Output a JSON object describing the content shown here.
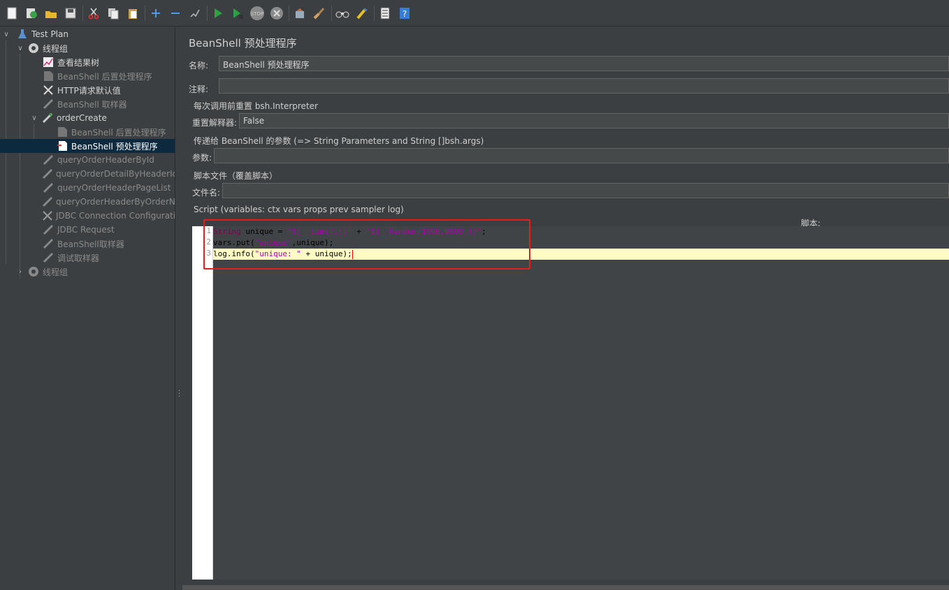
{
  "toolbar": {
    "buttons": [
      "new-icon",
      "templates-icon",
      "open-icon",
      "save-icon",
      "cut-icon",
      "copy-icon",
      "paste-icon",
      "expand-icon",
      "collapse-icon",
      "toggle-icon",
      "start-icon",
      "start-no-pause-icon",
      "stop-icon",
      "shutdown-icon",
      "clear-icon",
      "clear-all-icon",
      "search-icon",
      "reset-search-icon",
      "function-helper-icon",
      "help-icon"
    ]
  },
  "tree": {
    "items": [
      {
        "label": "Test Plan",
        "state": "active",
        "icon": "flask-icon"
      },
      {
        "label": "线程组",
        "state": "active",
        "icon": "gear-icon"
      },
      {
        "label": "查看结果树",
        "state": "active",
        "icon": "chart-icon"
      },
      {
        "label": "BeanShell 后置处理程序",
        "state": "disabled",
        "icon": "doc-icon"
      },
      {
        "label": "HTTP请求默认值",
        "state": "active",
        "icon": "wrench-icon"
      },
      {
        "label": "BeanShell 取样器",
        "state": "disabled",
        "icon": "pipette-icon"
      },
      {
        "label": "orderCreate",
        "state": "active",
        "icon": "pipette-icon"
      },
      {
        "label": "BeanShell 后置处理程序",
        "state": "disabled",
        "icon": "doc-icon"
      },
      {
        "label": "BeanShell 预处理程序",
        "state": "selected",
        "icon": "preprocessor-icon"
      },
      {
        "label": "queryOrderHeaderById",
        "state": "disabled",
        "icon": "pipette-icon"
      },
      {
        "label": "queryOrderDetailByHeaderId",
        "state": "disabled",
        "icon": "pipette-icon"
      },
      {
        "label": "queryOrderHeaderPageList",
        "state": "disabled",
        "icon": "pipette-icon"
      },
      {
        "label": "queryOrderHeaderByOrderNum",
        "state": "disabled",
        "icon": "pipette-icon"
      },
      {
        "label": "JDBC Connection Configuration",
        "state": "disabled",
        "icon": "wrench-icon"
      },
      {
        "label": "JDBC Request",
        "state": "disabled",
        "icon": "pipette-icon"
      },
      {
        "label": "BeanShell取样器",
        "state": "disabled",
        "icon": "pipette-icon"
      },
      {
        "label": "调试取样器",
        "state": "disabled",
        "icon": "pipette-icon"
      },
      {
        "label": "线程组",
        "state": "disabled",
        "icon": "gear-icon"
      }
    ]
  },
  "panel": {
    "title": "BeanShell 预处理程序",
    "name_label": "名称:",
    "name_value": "BeanShell 预处理程序",
    "comment_label": "注释:",
    "comment_value": "",
    "reset_group_title": "每次调用前重置 bsh.Interpreter",
    "reset_label": "重置解释器:",
    "reset_value": "False",
    "params_group_title": "传递给 BeanShell 的参数 (=> String Parameters and String []bsh.args)",
    "params_label": "参数:",
    "params_value": "",
    "file_group_title": "脚本文件（覆盖脚本）",
    "file_label": "文件名:",
    "file_value": "",
    "script_group_title": "Script (variables: ctx vars props prev sampler log)",
    "script_label": "脚本:"
  },
  "script": {
    "line_numbers": [
      "1",
      "2",
      "3"
    ],
    "line1": {
      "t1": "String",
      "t2": " unique = ",
      "t3": "\"${__time(,)}\"",
      "t4": " + ",
      "t5": "\"${__Random(1000,9999,)}\"",
      "t6": ";"
    },
    "line2": {
      "t1": "vars.put(",
      "t2": "\"unique\"",
      "t3": ",unique);"
    },
    "line3": {
      "t1": "log.info(",
      "t2": "\"unique: \"",
      "t3": " + unique);"
    }
  },
  "colors": {
    "selected_row": "#0d293e",
    "highlight_border": "#e02020",
    "current_line": "#fffbc4"
  }
}
